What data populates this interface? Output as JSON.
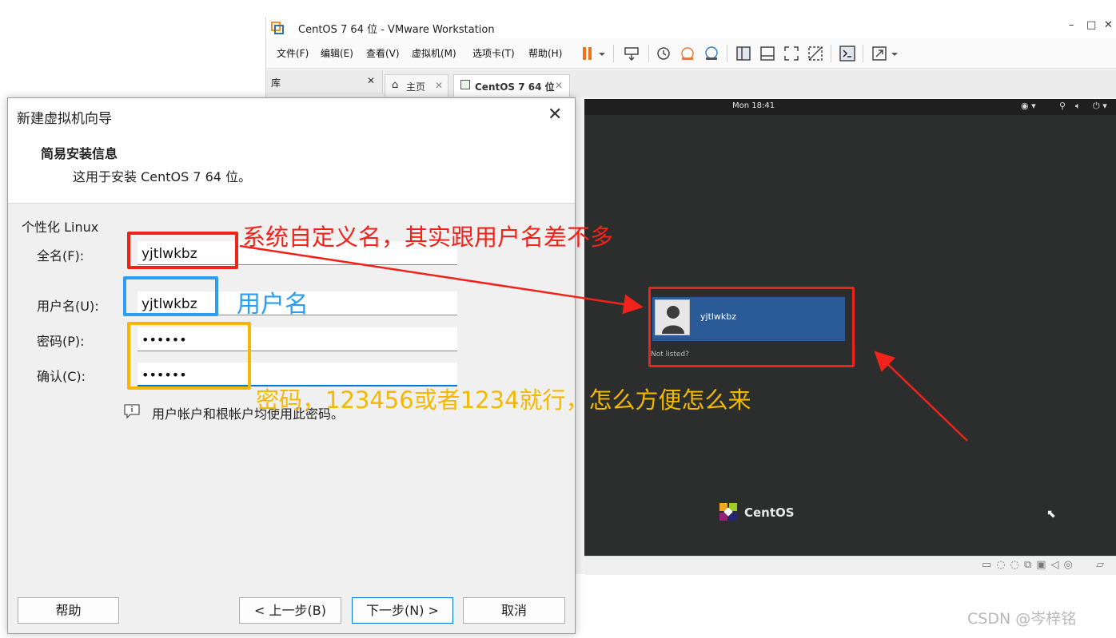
{
  "vmware": {
    "title": "CentOS 7 64 位 - VMware Workstation",
    "menu": [
      "文件(F)",
      "编辑(E)",
      "查看(V)",
      "虚拟机(M)",
      "选项卡(T)",
      "帮助(H)"
    ],
    "library_label": "库",
    "tabs": [
      {
        "label": "主页"
      },
      {
        "label": "CentOS 7 64 位"
      }
    ]
  },
  "vm": {
    "clock": "Mon 18:41",
    "user_name": "yjtlwkbz",
    "not_listed": "Not listed?",
    "os_logo_text": "CentOS"
  },
  "dialog": {
    "title": "新建虚拟机向导",
    "heading": "简易安装信息",
    "subheading": "这用于安装 CentOS 7 64 位。",
    "section": "个性化 Linux",
    "fields": [
      {
        "label": "全名(F):",
        "value": "yjtlwkbz"
      },
      {
        "label": "用户名(U):",
        "value": "yjtlwkbz"
      },
      {
        "label": "密码(P):",
        "value": "••••••"
      },
      {
        "label": "确认(C):",
        "value": "••••••"
      }
    ],
    "info_text": "用户帐户和根帐户均使用此密码。",
    "buttons": {
      "help": "帮助",
      "back": "< 上一步(B)",
      "next": "下一步(N) >",
      "cancel": "取消"
    }
  },
  "annotations": {
    "fullname_note": "系统自定义名，其实跟用户名差不多",
    "username_note": "用户名",
    "password_note": "密码，123456或者1234就行，怎么方便怎么来",
    "colors": {
      "red": "#f0231b",
      "blue": "#2a9df4",
      "yellow": "#f5b800"
    }
  },
  "watermark": "CSDN @岑梓铭"
}
